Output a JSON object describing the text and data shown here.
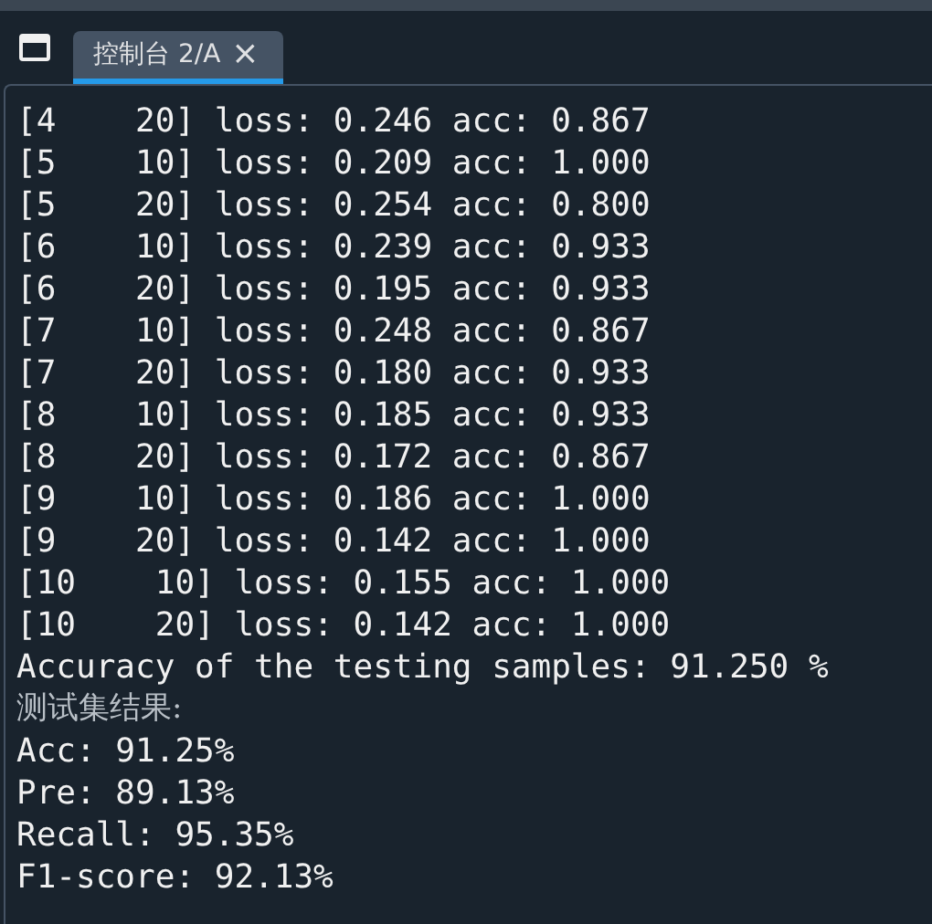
{
  "tab": {
    "label": "控制台 2/A",
    "close": "×",
    "selected": true
  },
  "console_lines": [
    {
      "kind": "output",
      "text": "[4    20] loss: 0.246 acc: 0.867"
    },
    {
      "kind": "output",
      "text": "[5    10] loss: 0.209 acc: 1.000"
    },
    {
      "kind": "output",
      "text": "[5    20] loss: 0.254 acc: 0.800"
    },
    {
      "kind": "output",
      "text": "[6    10] loss: 0.239 acc: 0.933"
    },
    {
      "kind": "output",
      "text": "[6    20] loss: 0.195 acc: 0.933"
    },
    {
      "kind": "output",
      "text": "[7    10] loss: 0.248 acc: 0.867"
    },
    {
      "kind": "output",
      "text": "[7    20] loss: 0.180 acc: 0.933"
    },
    {
      "kind": "output",
      "text": "[8    10] loss: 0.185 acc: 0.933"
    },
    {
      "kind": "output",
      "text": "[8    20] loss: 0.172 acc: 0.867"
    },
    {
      "kind": "output",
      "text": "[9    10] loss: 0.186 acc: 1.000"
    },
    {
      "kind": "output",
      "text": "[9    20] loss: 0.142 acc: 1.000"
    },
    {
      "kind": "output",
      "text": "[10    10] loss: 0.155 acc: 1.000"
    },
    {
      "kind": "output",
      "text": "[10    20] loss: 0.142 acc: 1.000"
    },
    {
      "kind": "output",
      "text": "Accuracy of the testing samples: 91.250 %"
    },
    {
      "kind": "heading",
      "text": "测试集结果:"
    },
    {
      "kind": "output",
      "text": "Acc: 91.25%"
    },
    {
      "kind": "output",
      "text": "Pre: 89.13%"
    },
    {
      "kind": "output",
      "text": "Recall: 95.35%"
    },
    {
      "kind": "output",
      "text": "F1-score: 92.13%"
    }
  ]
}
